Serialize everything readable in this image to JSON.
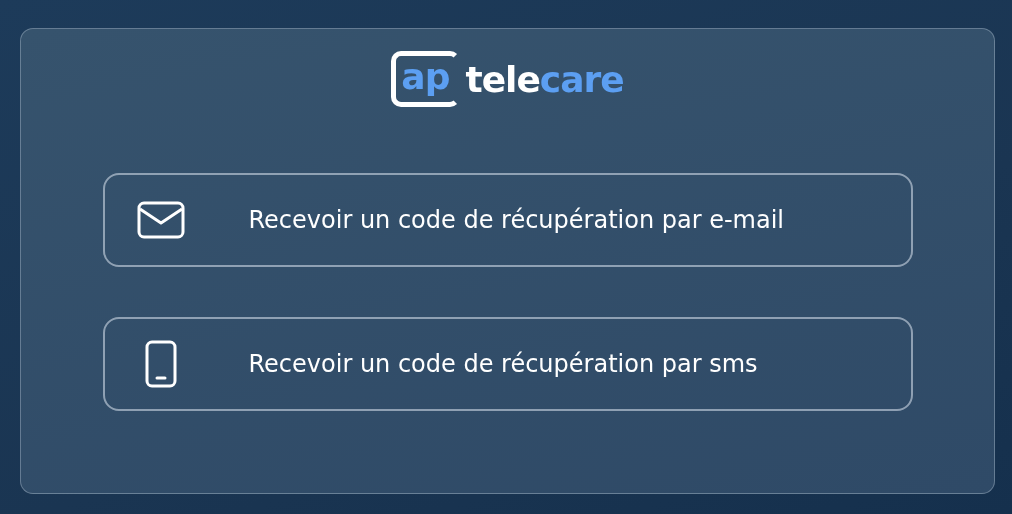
{
  "logo": {
    "parts": [
      {
        "text": "ap",
        "kind": "framed"
      },
      {
        "text": "tele",
        "kind": "plain"
      },
      {
        "text": "care",
        "kind": "accent"
      }
    ]
  },
  "options": [
    {
      "kind": "email",
      "label": "Recevoir un code de récupération par e-mail"
    },
    {
      "kind": "sms",
      "label": "Recevoir un code de récupération par sms"
    }
  ]
}
